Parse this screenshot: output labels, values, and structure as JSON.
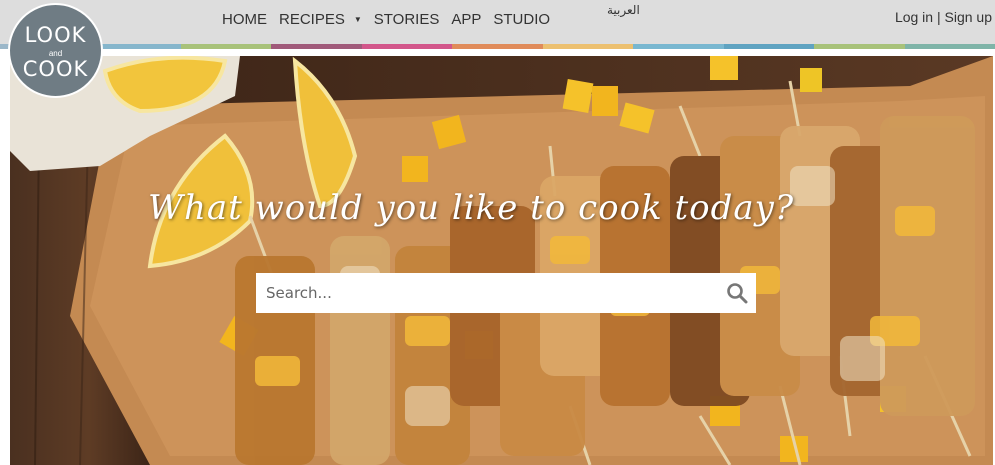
{
  "header": {
    "logo": {
      "line1": "LOOK",
      "line2": "and",
      "line3": "COOK"
    },
    "nav": [
      {
        "label": "HOME"
      },
      {
        "label": "RECIPES"
      },
      {
        "label": "STORIES"
      },
      {
        "label": "APP"
      },
      {
        "label": "STUDIO"
      }
    ],
    "language_link": "العربية",
    "auth": {
      "login": "Log in",
      "separator": "|",
      "signup": "Sign up"
    },
    "stripe_colors": [
      "#9bb7c9",
      "#86b6cc",
      "#a8c27a",
      "#a05a7a",
      "#d2568a",
      "#e08b5a",
      "#ecc070",
      "#79b7d0",
      "#5fa3c1",
      "#a8c27a",
      "#7fb4a8"
    ]
  },
  "hero": {
    "tagline": "What would you like to cook today?",
    "search": {
      "placeholder": "Search...",
      "value": ""
    },
    "icons": {
      "search": "search-icon",
      "caret": "caret-down-icon"
    }
  }
}
